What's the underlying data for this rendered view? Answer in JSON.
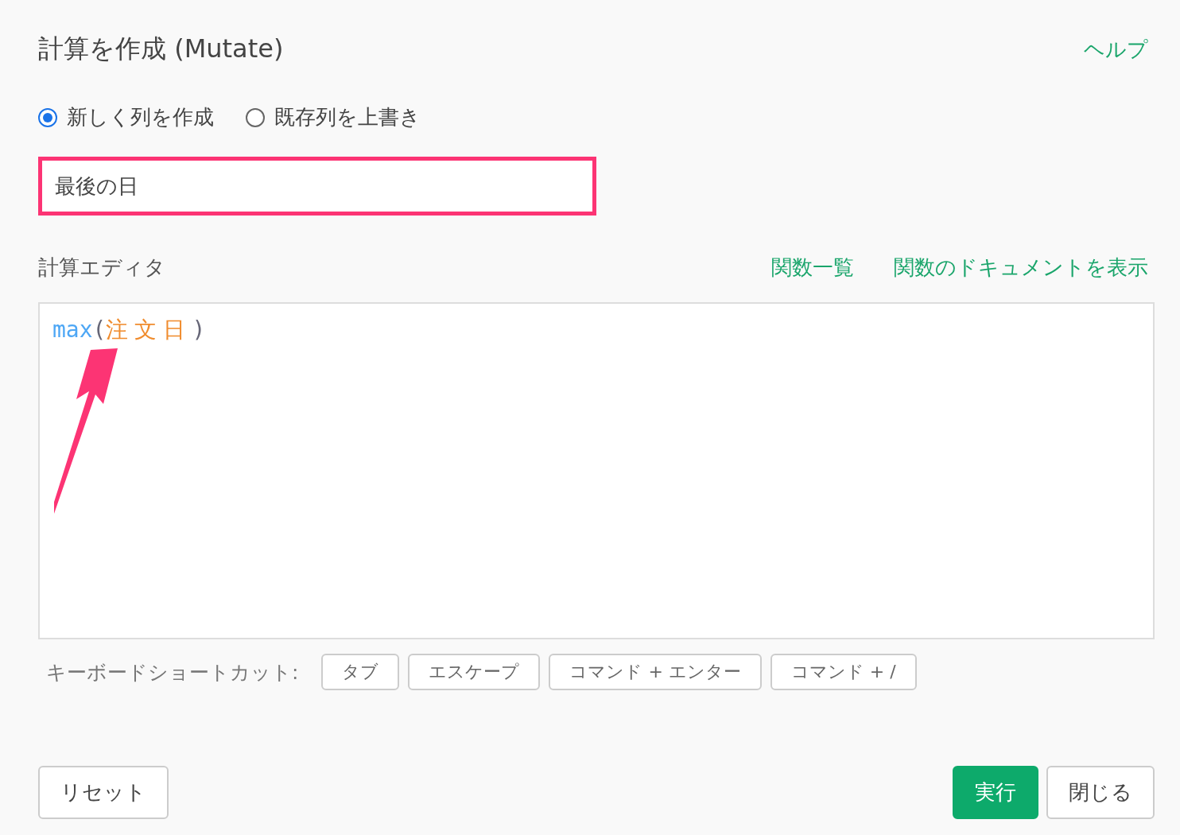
{
  "dialog": {
    "title": "計算を作成 (Mutate)",
    "help_link": "ヘルプ"
  },
  "modes": [
    {
      "label": "新しく列を作成",
      "selected": true
    },
    {
      "label": "既存列を上書き",
      "selected": false
    }
  ],
  "column_name": {
    "value": "最後の日",
    "highlighted": true
  },
  "editor": {
    "label": "計算エディタ",
    "links": [
      "関数一覧",
      "関数のドキュメントを表示"
    ],
    "tokens": [
      {
        "kind": "function",
        "text": "max"
      },
      {
        "kind": "paren",
        "text": "("
      },
      {
        "kind": "column",
        "text": "注文日"
      },
      {
        "kind": "paren",
        "text": ")"
      }
    ],
    "arrow_annotation": true
  },
  "shortcuts": {
    "label": "キーボードショートカット:",
    "keys": [
      "タブ",
      "エスケープ",
      "コマンド + エンター",
      "コマンド + /"
    ]
  },
  "buttons": {
    "reset": "リセット",
    "run": "実行",
    "close": "閉じる"
  }
}
